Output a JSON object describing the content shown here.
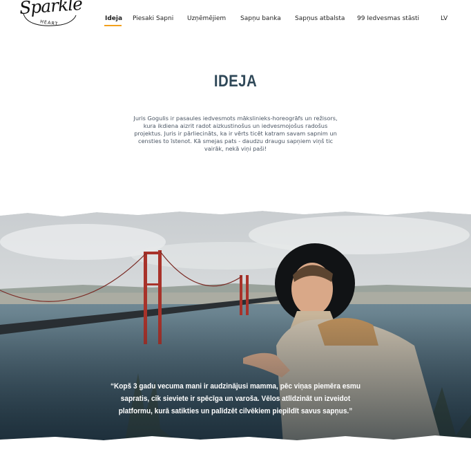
{
  "brand": {
    "logo_word": "Sparkle",
    "logo_sub": "HEART"
  },
  "nav": {
    "items": [
      {
        "label": "Ideja",
        "active": true
      },
      {
        "label": "Piesaki Sapni",
        "active": false
      },
      {
        "label": "Uzņēmējiem",
        "active": false
      },
      {
        "label": "Sapņu banka",
        "active": false
      },
      {
        "label": "Sapņus atbalsta",
        "active": false
      },
      {
        "label": "99 Iedvesmas stāsti",
        "active": false
      }
    ],
    "language": "LV",
    "accent_color": "#f2a01c"
  },
  "idea": {
    "title": "IDEJA",
    "text": "Juris Gogulis ir pasaules iedvesmots mākslinieks-horeogrāfs un režisors, kura ikdiena aizrit radot aizkustinošus un iedvesmojošus radošus projektus. Juris ir pārliecināts, ka ir vērts ticēt katram savam sapnim un censties to īstenot. Kā smejas pats - daudzu draugu sapņiem viņš tic vairāk, nekā viņi paši!"
  },
  "hero": {
    "quote": "“Kopš 3 gadu vecuma mani ir audzinājusi mamma, pēc viņas piemēra esmu sapratis, cik sieviete ir spēcīga un varoša. Vēlos atlīdzināt un izveidot platformu, kurā satikties un palīdzēt cilvēkiem piepildīt savus sapņus.”"
  }
}
